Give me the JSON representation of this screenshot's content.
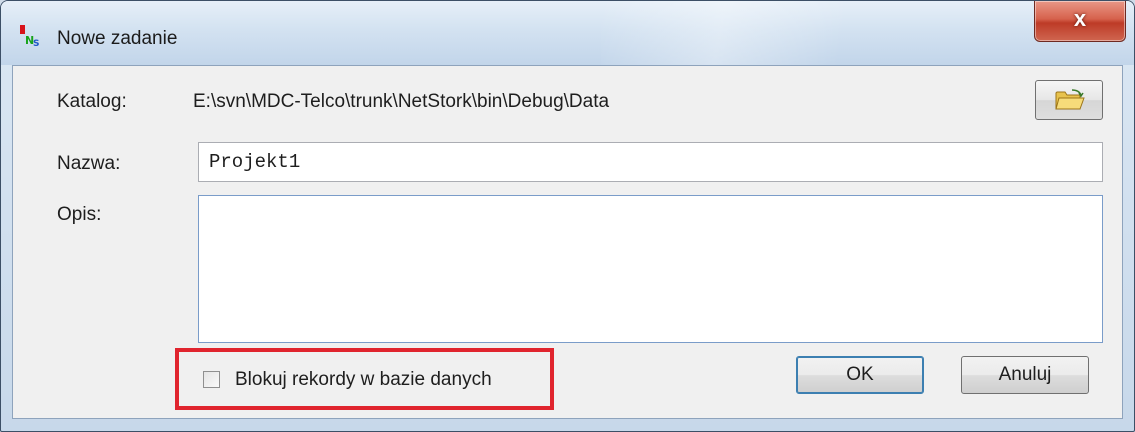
{
  "window": {
    "title": "Nowe zadanie",
    "close_label": "x"
  },
  "form": {
    "catalog_label": "Katalog:",
    "catalog_path": "E:\\svn\\MDC-Telco\\trunk\\NetStork\\bin\\Debug\\Data",
    "name_label": "Nazwa:",
    "name_value": "Projekt1",
    "description_label": "Opis:",
    "description_value": "",
    "lock_records_label": "Blokuj rekordy w bazie danych",
    "lock_records_checked": false
  },
  "buttons": {
    "ok_label": "OK",
    "cancel_label": "Anuluj"
  },
  "icons": {
    "app": "app-logo-icon",
    "browse": "folder-open-icon"
  },
  "colors": {
    "highlight": "#e0242e",
    "close_button": "#c94a35"
  }
}
